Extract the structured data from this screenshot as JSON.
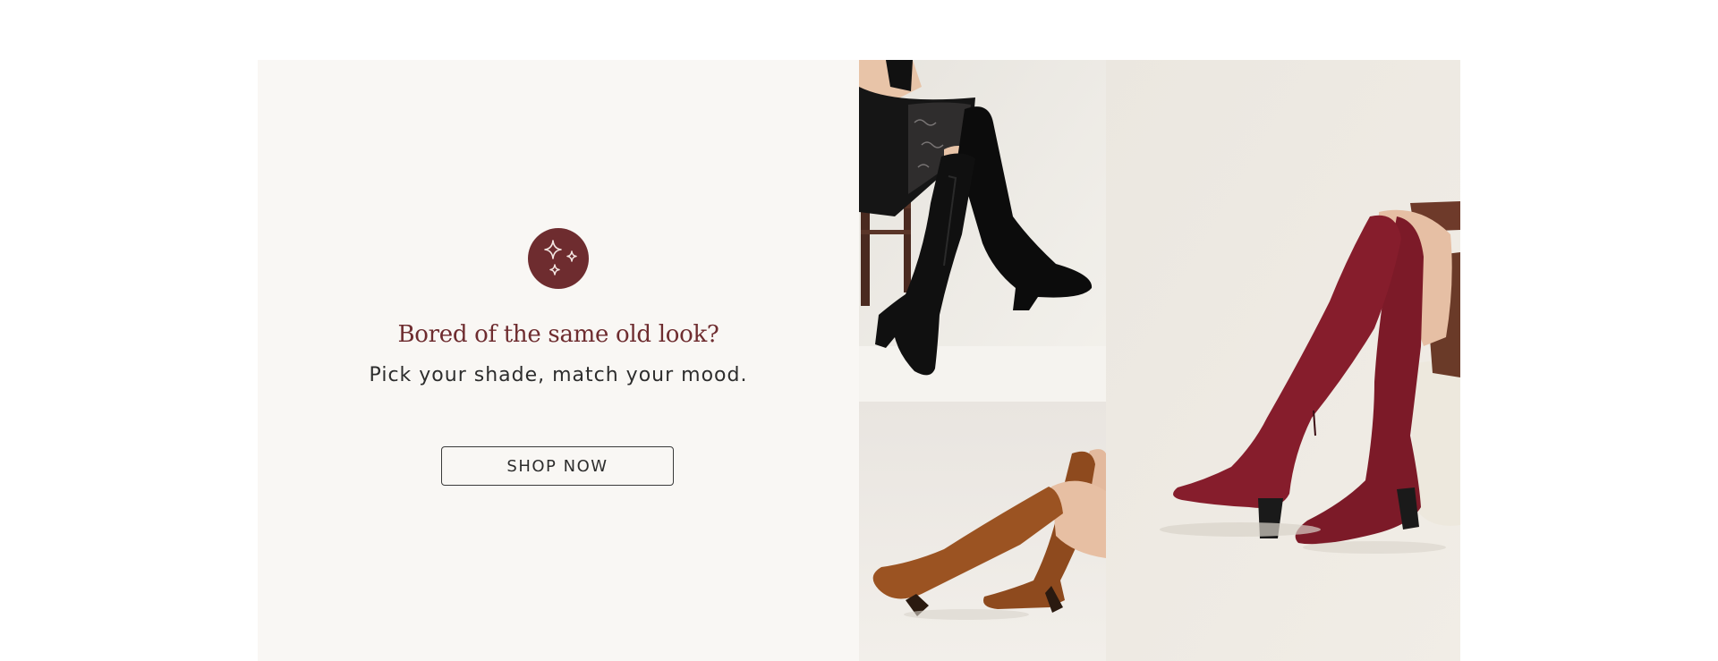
{
  "promo": {
    "headline": "Bored of the same old look?",
    "subline": "Pick your shade, match your mood.",
    "cta_label": "SHOP NOW",
    "badge_icon": "sparkles-icon"
  },
  "colors": {
    "accent": "#6e2c2f",
    "panel_background": "#f9f7f4",
    "text": "#2d2d2d"
  },
  "gallery": {
    "images": [
      {
        "subject": "black velvet over-the-knee boots"
      },
      {
        "subject": "cognac brown knee-high boots"
      },
      {
        "subject": "burgundy over-the-knee boots"
      }
    ]
  }
}
